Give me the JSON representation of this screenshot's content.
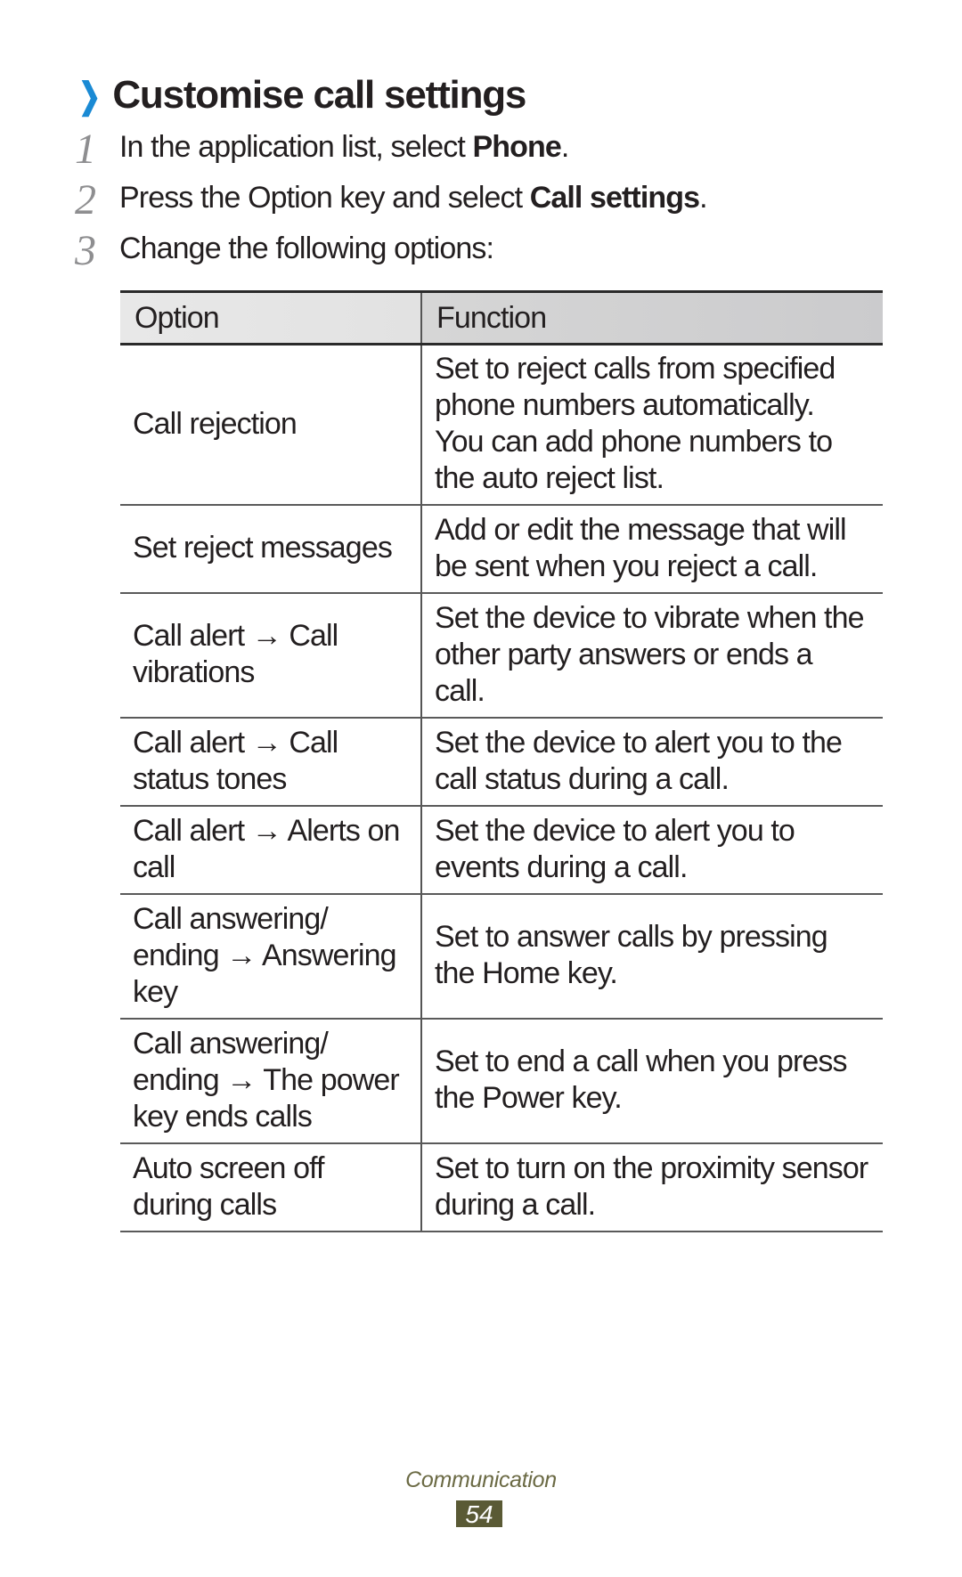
{
  "section": {
    "title": "Customise call settings",
    "icon": "chevron-right-icon",
    "accent_color": "#1a8ad4"
  },
  "steps": [
    {
      "number": "1",
      "text_before": "In the application list, select ",
      "bold": "Phone",
      "text_after": "."
    },
    {
      "number": "2",
      "text_before": "Press the Option key and select ",
      "bold": "Call settings",
      "text_after": "."
    },
    {
      "number": "3",
      "text_before": "Change the following options:",
      "bold": "",
      "text_after": ""
    }
  ],
  "table": {
    "headers": [
      "Option",
      "Function"
    ],
    "rows": [
      {
        "option": "Call rejection",
        "function": "Set to reject calls from specified phone numbers automatically. You can add phone numbers to the auto reject list."
      },
      {
        "option": "Set reject messages",
        "function": "Add or edit the message that will be sent when you reject a call."
      },
      {
        "option": "Call alert → Call vibrations",
        "function": "Set the device to vibrate when the other party answers or ends a call."
      },
      {
        "option": "Call alert → Call status tones",
        "function": "Set the device to alert you to the call status during a call."
      },
      {
        "option": "Call alert → Alerts on call",
        "function": "Set the device to alert you to events during a call."
      },
      {
        "option": "Call answering/ ending → Answering key",
        "function": "Set to answer calls by pressing the Home key."
      },
      {
        "option": "Call answering/ ending → The power key ends calls",
        "function": "Set to end a call when you press the Power key."
      },
      {
        "option": "Auto screen off during calls",
        "function": "Set to turn on the proximity sensor during a call."
      }
    ]
  },
  "footer": {
    "chapter": "Communication",
    "page_number": "54",
    "badge_color": "#5a5a35"
  }
}
